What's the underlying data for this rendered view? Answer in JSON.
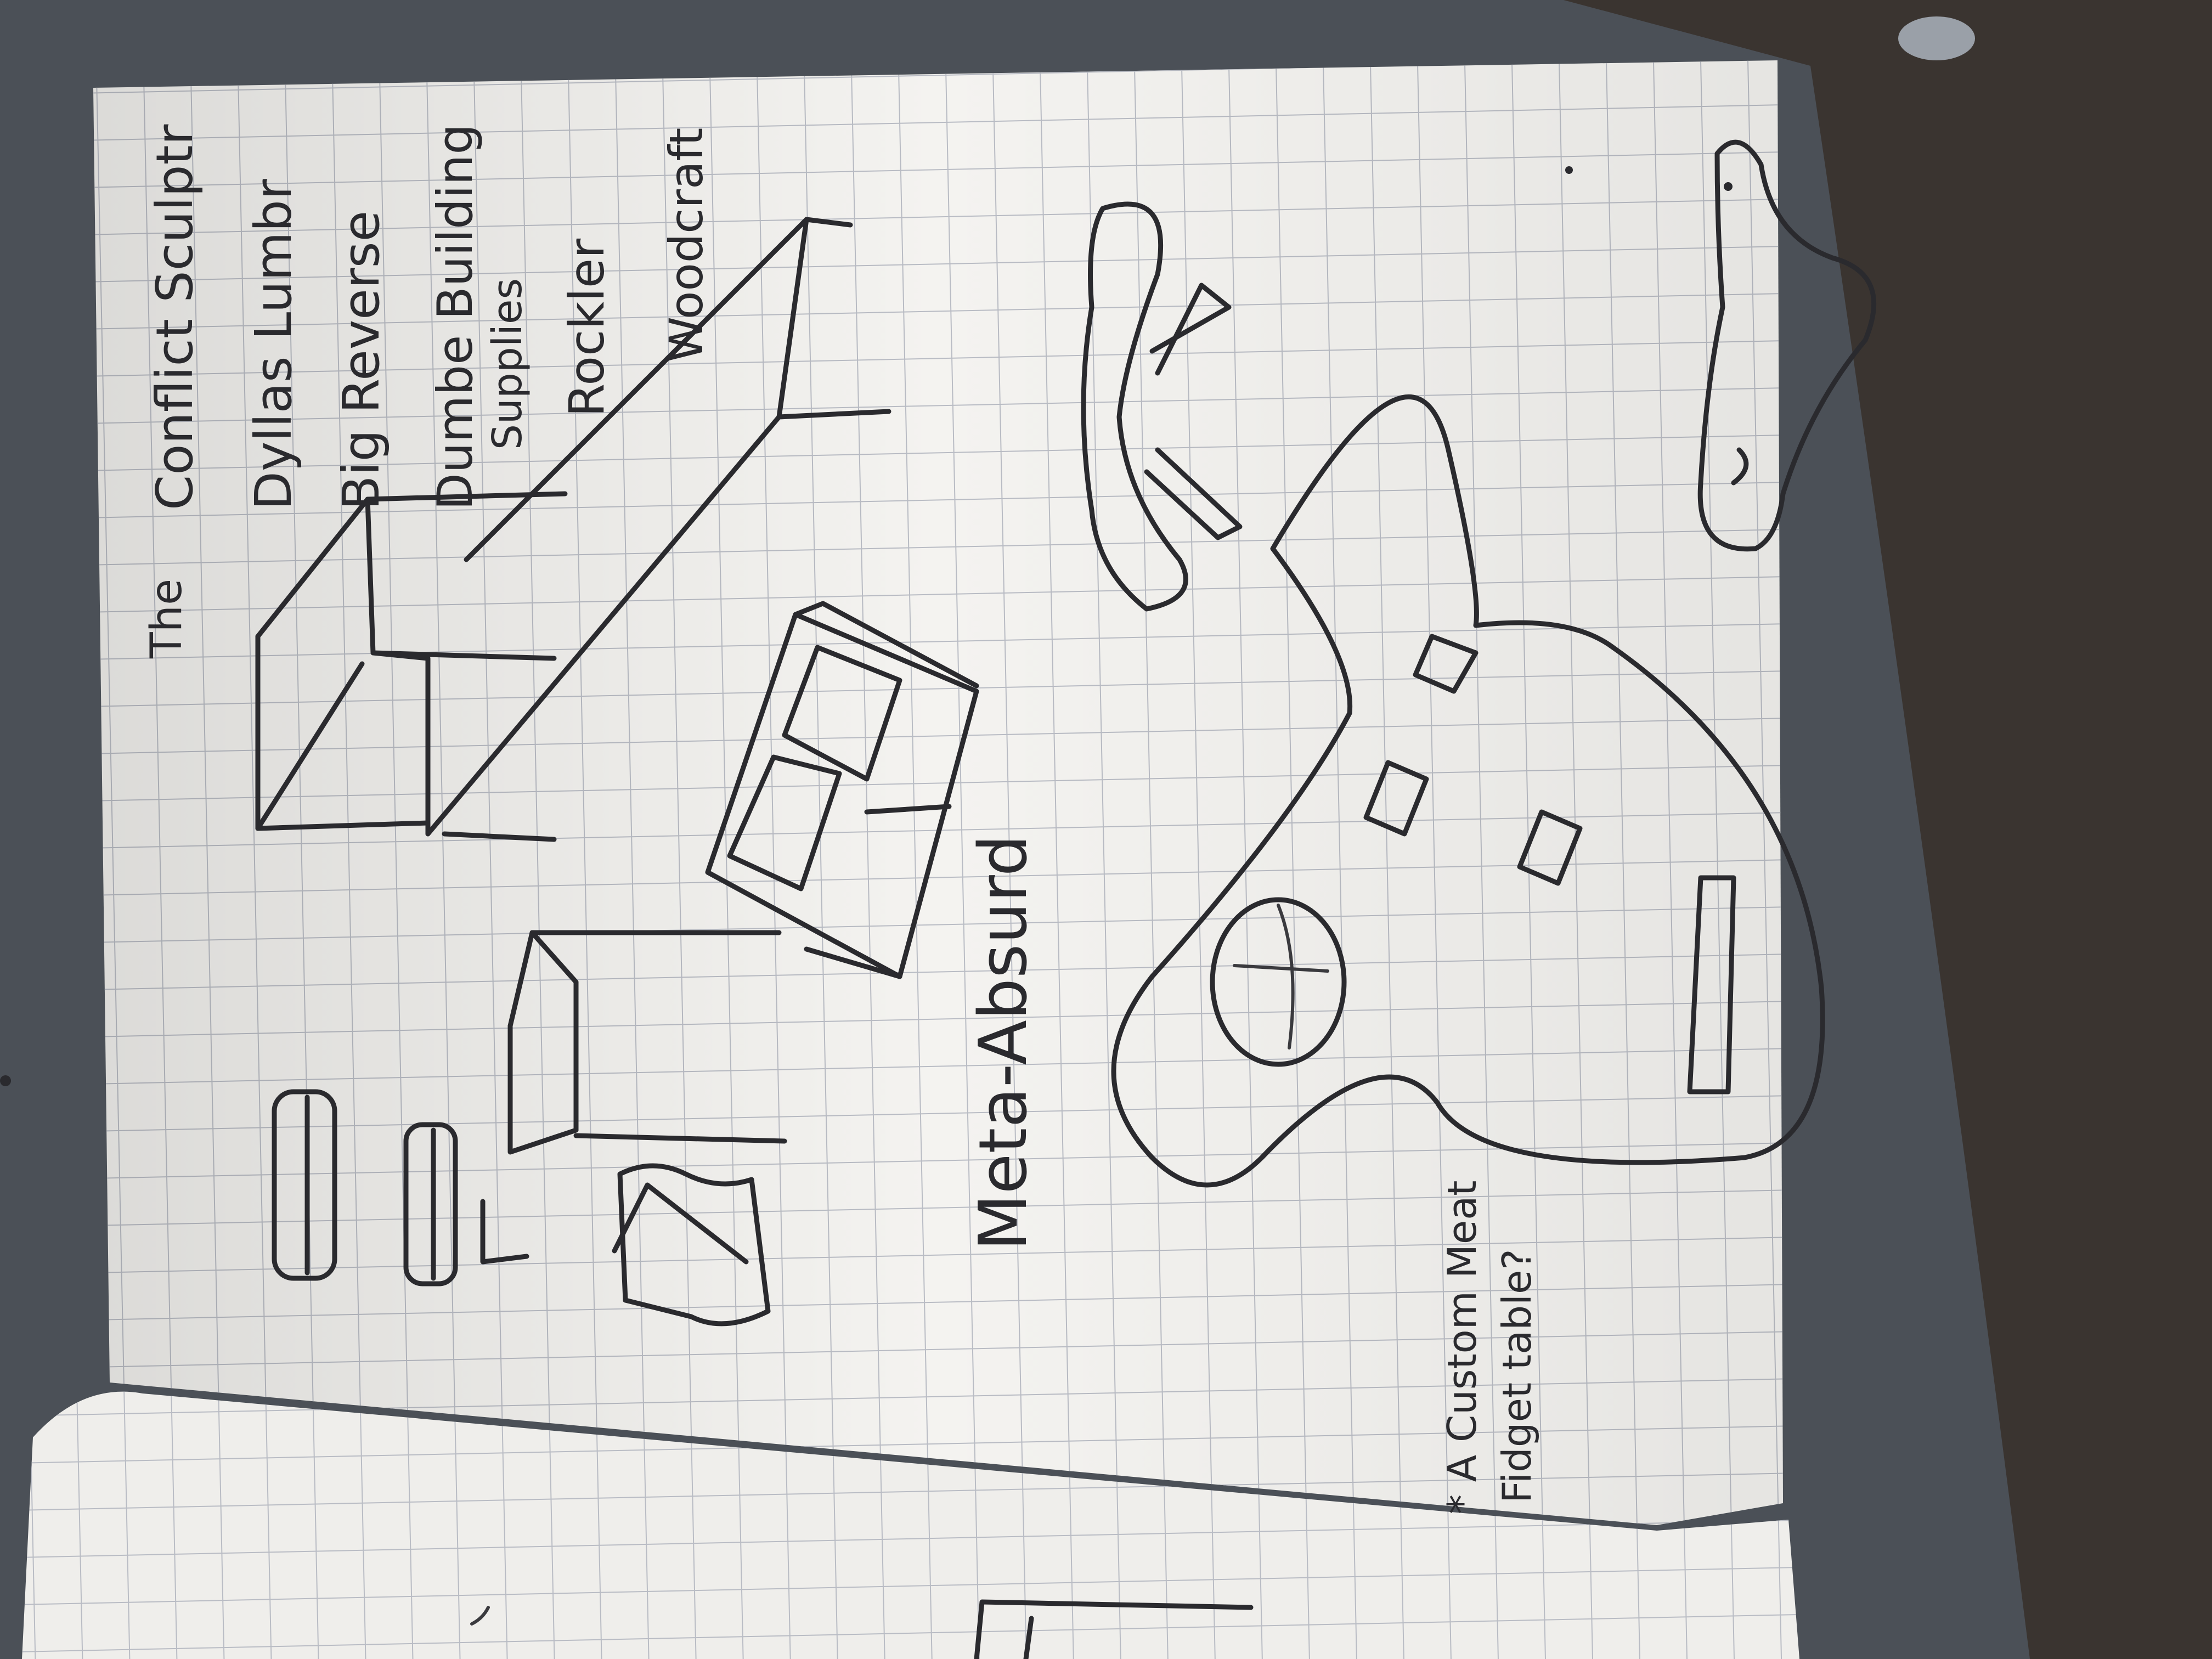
{
  "notebook": {
    "page_texts": {
      "title_word": "The",
      "ideas": [
        "Conflict Sculptr",
        "Dyllas Lumbr",
        "Big Reverse",
        "Dumbe Building",
        "Supplies",
        "Rockler",
        "Woodcraft"
      ],
      "meta_label": "Meta-Absurd",
      "note_line1": "* A Custom Meat",
      "note_line2": "Fidget table?"
    },
    "colors": {
      "paper": "#f4f3f0",
      "grid": "#b9bcc4",
      "ink": "#2a2a2e",
      "background": "#4a4f55"
    }
  }
}
